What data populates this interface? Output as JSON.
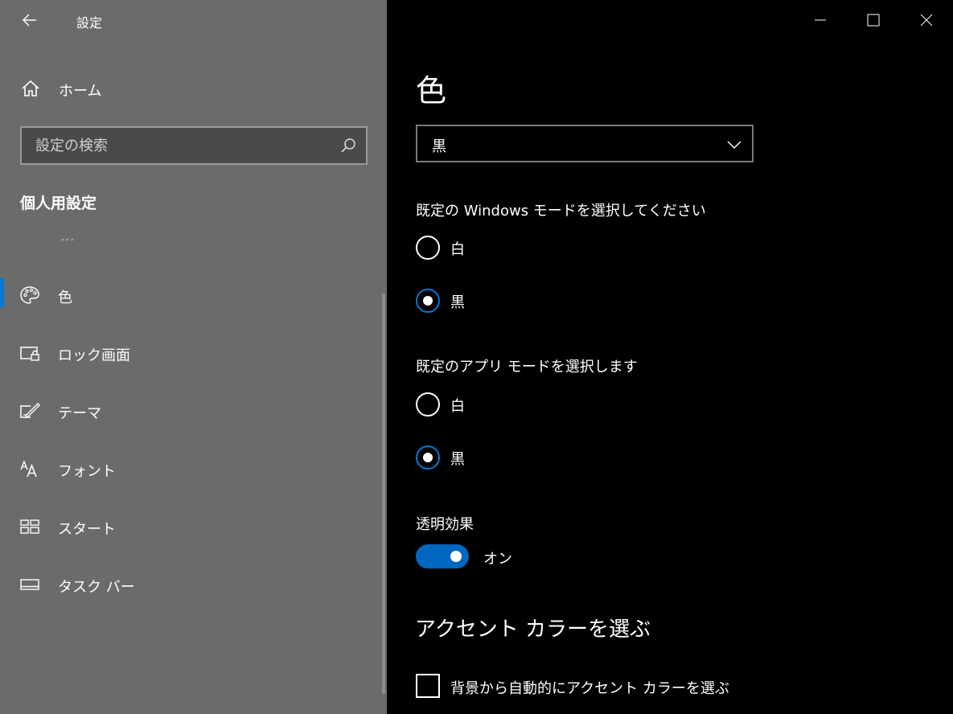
{
  "window": {
    "title": "設定"
  },
  "sidebar": {
    "home_label": "ホーム",
    "search_placeholder": "設定の検索",
    "section_heading": "個人用設定",
    "scroll_cutoff_text": "ﾞﾞﾞ",
    "items": [
      {
        "label": "色",
        "icon": "palette-icon",
        "selected": true
      },
      {
        "label": "ロック画面",
        "icon": "lock-screen-icon"
      },
      {
        "label": "テーマ",
        "icon": "theme-icon"
      },
      {
        "label": "フォント",
        "icon": "font-icon"
      },
      {
        "label": "スタート",
        "icon": "start-icon"
      },
      {
        "label": "タスク バー",
        "icon": "taskbar-icon"
      }
    ]
  },
  "main": {
    "page_title": "色",
    "color_dropdown_value": "黒",
    "windows_mode": {
      "label": "既定の Windows モードを選択してください",
      "options": [
        "白",
        "黒"
      ],
      "selected": "黒"
    },
    "app_mode": {
      "label": "既定のアプリ モードを選択します",
      "options": [
        "白",
        "黒"
      ],
      "selected": "黒"
    },
    "transparency": {
      "label": "透明効果",
      "state": "オン"
    },
    "accent_heading": "アクセント カラーを選ぶ",
    "auto_accent_label": "背景から自動的にアクセント カラーを選ぶ"
  },
  "colors": {
    "sidebar_bg": "#6b6b6b",
    "main_bg": "#000000",
    "accent": "#0078d4"
  }
}
